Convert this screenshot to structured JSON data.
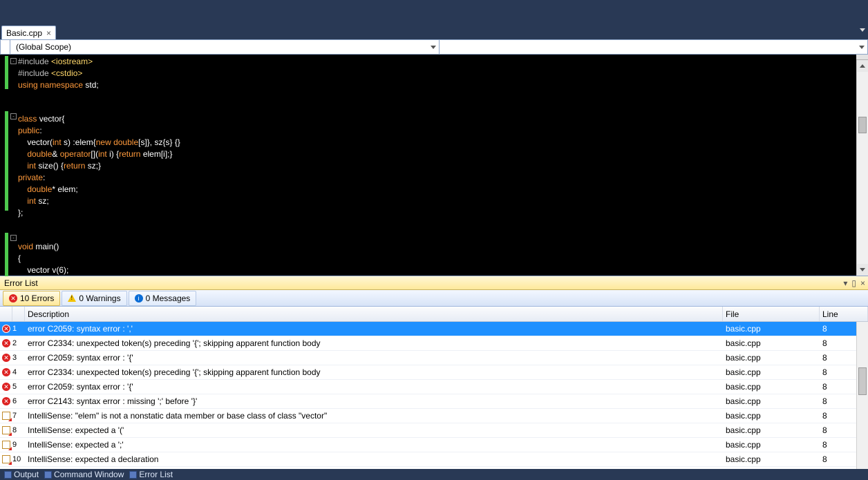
{
  "tab": {
    "label": "Basic.cpp"
  },
  "scope": {
    "left": "(Global Scope)",
    "right": ""
  },
  "code_lines": [
    [
      [
        "pre",
        "#include "
      ],
      [
        "str",
        "<iostream>"
      ]
    ],
    [
      [
        "pre",
        "#include "
      ],
      [
        "str",
        "<cstdio>"
      ]
    ],
    [
      [
        "kw",
        "using "
      ],
      [
        "kw",
        "namespace "
      ],
      [
        "id",
        "std"
      ],
      [
        "punc",
        ";"
      ]
    ],
    [],
    [],
    [
      [
        "kw",
        "class "
      ],
      [
        "id",
        "vector"
      ],
      [
        "punc",
        "{"
      ]
    ],
    [
      [
        "kw",
        "public"
      ],
      [
        "punc",
        ":"
      ]
    ],
    [
      [
        "id",
        "    vector"
      ],
      [
        "punc",
        "("
      ],
      [
        "type",
        "int "
      ],
      [
        "id",
        "s"
      ],
      [
        "punc",
        ") :elem{"
      ],
      [
        "new",
        "new "
      ],
      [
        "type",
        "double"
      ],
      [
        "punc",
        "[s]}, sz{s} {}"
      ]
    ],
    [
      [
        "type",
        "    double"
      ],
      [
        "op",
        "& "
      ],
      [
        "kw",
        "operator"
      ],
      [
        "punc",
        "[]("
      ],
      [
        "type",
        "int "
      ],
      [
        "id",
        "i"
      ],
      [
        "punc",
        ") {"
      ],
      [
        "kw",
        "return "
      ],
      [
        "id",
        "elem[i];}"
      ]
    ],
    [
      [
        "type",
        "    int "
      ],
      [
        "id",
        "size"
      ],
      [
        "punc",
        "() {"
      ],
      [
        "kw",
        "return "
      ],
      [
        "id",
        "sz;}"
      ]
    ],
    [
      [
        "kw",
        "private"
      ],
      [
        "punc",
        ":"
      ]
    ],
    [
      [
        "type",
        "    double"
      ],
      [
        "op",
        "* "
      ],
      [
        "id",
        "elem"
      ],
      [
        "punc",
        ";"
      ]
    ],
    [
      [
        "type",
        "    int "
      ],
      [
        "id",
        "sz"
      ],
      [
        "punc",
        ";"
      ]
    ],
    [
      [
        "punc",
        "};"
      ]
    ],
    [],
    [],
    [
      [
        "type",
        "void "
      ],
      [
        "id",
        "main"
      ],
      [
        "punc",
        "()"
      ]
    ],
    [
      [
        "punc",
        "{"
      ]
    ],
    [
      [
        "id",
        "    vector v"
      ],
      [
        "punc",
        "(6);"
      ]
    ],
    [
      [
        "punc",
        "}"
      ]
    ]
  ],
  "folds": [
    0,
    5,
    16
  ],
  "change_marks": [
    [
      0,
      3
    ],
    [
      5,
      14
    ],
    [
      16,
      20
    ]
  ],
  "error_panel": {
    "title": "Error List",
    "toolbar": {
      "errors": "10 Errors",
      "warnings": "0 Warnings",
      "messages": "0 Messages"
    },
    "columns": {
      "desc": "Description",
      "file": "File",
      "line": "Line"
    },
    "rows": [
      {
        "icon": "err",
        "n": "1",
        "desc": "error C2059: syntax error : ','",
        "file": "basic.cpp",
        "line": "8",
        "selected": true
      },
      {
        "icon": "err",
        "n": "2",
        "desc": "error C2334: unexpected token(s) preceding '{'; skipping apparent function body",
        "file": "basic.cpp",
        "line": "8"
      },
      {
        "icon": "err",
        "n": "3",
        "desc": "error C2059: syntax error : '{'",
        "file": "basic.cpp",
        "line": "8"
      },
      {
        "icon": "err",
        "n": "4",
        "desc": "error C2334: unexpected token(s) preceding '{'; skipping apparent function body",
        "file": "basic.cpp",
        "line": "8"
      },
      {
        "icon": "err",
        "n": "5",
        "desc": "error C2059: syntax error : '{'",
        "file": "basic.cpp",
        "line": "8"
      },
      {
        "icon": "err",
        "n": "6",
        "desc": "error C2143: syntax error : missing ';' before '}'",
        "file": "basic.cpp",
        "line": "8"
      },
      {
        "icon": "intel",
        "n": "7",
        "desc": "IntelliSense: \"elem\" is not a nonstatic data member or base class of class \"vector\"",
        "file": "basic.cpp",
        "line": "8"
      },
      {
        "icon": "intel",
        "n": "8",
        "desc": "IntelliSense: expected a '('",
        "file": "basic.cpp",
        "line": "8"
      },
      {
        "icon": "intel",
        "n": "9",
        "desc": "IntelliSense: expected a ';'",
        "file": "basic.cpp",
        "line": "8"
      },
      {
        "icon": "intel",
        "n": "10",
        "desc": "IntelliSense: expected a declaration",
        "file": "basic.cpp",
        "line": "8"
      }
    ]
  },
  "status_tabs": [
    "Output",
    "Command Window",
    "Error List"
  ]
}
